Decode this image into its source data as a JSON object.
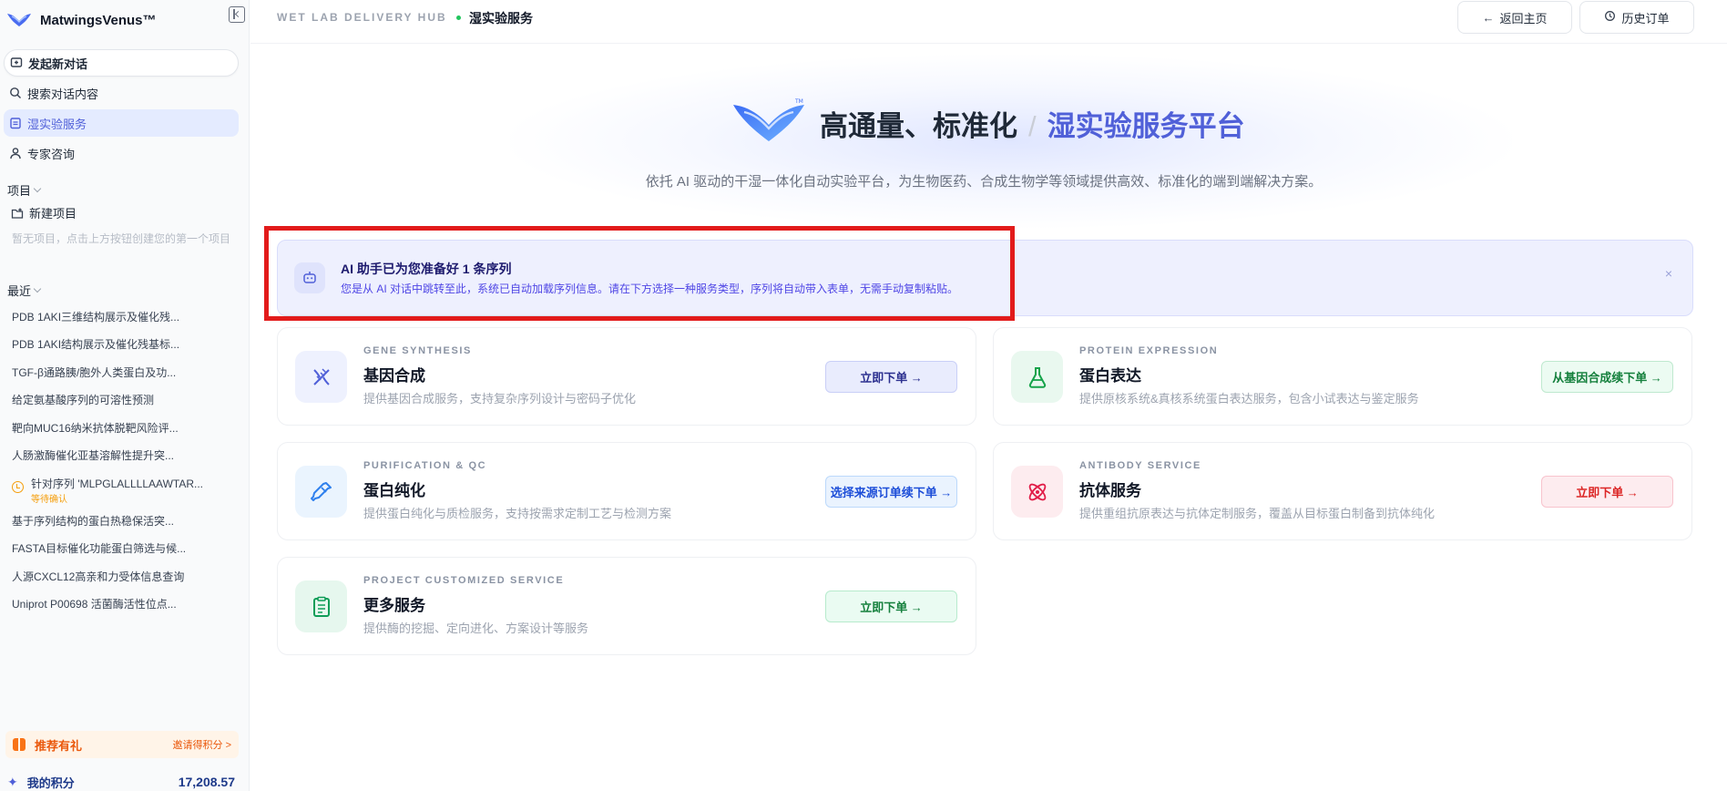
{
  "app": {
    "name": "MatwingsVenus™"
  },
  "sidebar": {
    "nav": {
      "new_chat": "发起新对话",
      "search": "搜索对话内容",
      "wetlab": "湿实验服务",
      "expert": "专家咨询"
    },
    "projects": {
      "title": "项目",
      "new_project": "新建项目",
      "empty": "暂无项目，点击上方按钮创建您的第一个项目"
    },
    "recent": {
      "title": "最近",
      "items": [
        "PDB 1AKI三维结构展示及催化残...",
        "PDB 1AKI结构展示及催化残基标...",
        "TGF-β通路胰/胞外人类蛋白及功...",
        "给定氨基酸序列的可溶性预测",
        "靶向MUC16纳米抗体脱靶风险评...",
        "人肠激酶催化亚基溶解性提升突..."
      ],
      "pending": {
        "title": "针对序列 'MLPGLALLLLAAWTAR...",
        "status": "等待确认"
      },
      "items_after": [
        "基于序列结构的蛋白热稳保活突...",
        "FASTA目标催化功能蛋白筛选与候...",
        "人源CXCL12高亲和力受体信息查询",
        "Uniprot P00698 活菌酶活性位点..."
      ]
    },
    "referral": {
      "label": "推荐有礼",
      "link": "邀请得积分 >"
    },
    "points": {
      "label": "我的积分",
      "value": "17,208.57"
    }
  },
  "header": {
    "breadcrumb_en": "WET LAB DELIVERY HUB",
    "breadcrumb_cn": "湿实验服务",
    "home_button": "返回主页",
    "history_button": "历史订单"
  },
  "hero": {
    "title_main": "高通量、标准化",
    "title_sep": "/",
    "title_accent": "湿实验服务平台",
    "subtitle": "依托 AI 驱动的干湿一体化自动实验平台，为生物医药、合成生物学等领域提供高效、标准化的端到端解决方案。"
  },
  "ai_banner": {
    "title": "AI 助手已为您准备好 1 条序列",
    "description": "您是从 AI 对话中跳转至此，系统已自动加载序列信息。请在下方选择一种服务类型，序列将自动带入表单，无需手动复制粘贴。",
    "close": "×"
  },
  "services": {
    "gene": {
      "en": "GENE SYNTHESIS",
      "title": "基因合成",
      "desc": "提供基因合成服务，支持复杂序列设计与密码子优化",
      "button": "立即下单 →"
    },
    "protein": {
      "en": "PROTEIN EXPRESSION",
      "title": "蛋白表达",
      "desc": "提供原核系统&真核系统蛋白表达服务，包含小试表达与鉴定服务",
      "button": "从基因合成续下单 →"
    },
    "purify": {
      "en": "PURIFICATION & QC",
      "title": "蛋白纯化",
      "desc": "提供蛋白纯化与质检服务，支持按需求定制工艺与检测方案",
      "button": "选择来源订单续下单 →"
    },
    "antibody": {
      "en": "ANTIBODY SERVICE",
      "title": "抗体服务",
      "desc": "提供重组抗原表达与抗体定制服务，覆盖从目标蛋白制备到抗体纯化",
      "button": "立即下单 →"
    },
    "more": {
      "en": "PROJECT CUSTOMIZED SERVICE",
      "title": "更多服务",
      "desc": "提供酶的挖掘、定向进化、方案设计等服务",
      "button": "立即下单 →"
    }
  },
  "colors": {
    "accent": "#5060d8",
    "highlight_box": "#e21b1b",
    "success": "#22c55e",
    "warning": "#f59e0b",
    "danger": "#dc2626"
  }
}
